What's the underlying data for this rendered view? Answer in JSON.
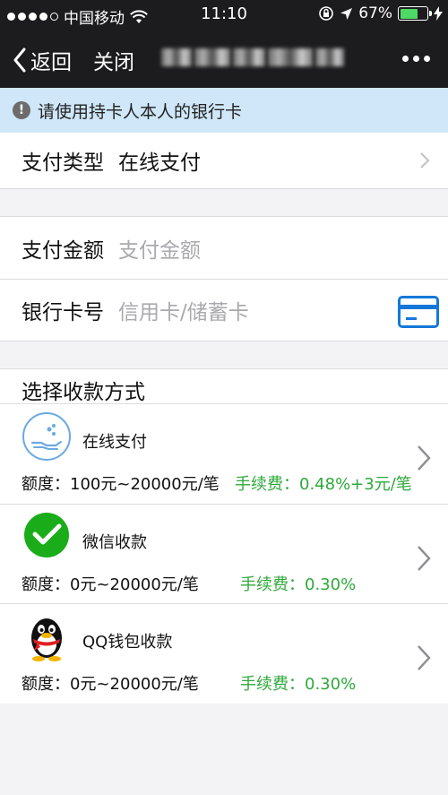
{
  "status_bar": {
    "carrier": "中国移动",
    "time": "11:10",
    "battery": "67%",
    "battery_level": 0.67
  },
  "nav": {
    "back_label": "返回",
    "close_label": "关闭"
  },
  "notice": {
    "text": "请使用持卡人本人的银行卡"
  },
  "form": {
    "pay_type_label": "支付类型",
    "pay_type_value": "在线支付",
    "amount_label": "支付金额",
    "amount_placeholder": "支付金额",
    "card_label": "银行卡号",
    "card_placeholder": "信用卡/储蓄卡"
  },
  "methods_title": "选择收款方式",
  "methods": [
    {
      "name": "在线支付",
      "limit": "额度：100元~20000元/笔",
      "fee": "手续费：0.48%+3元/笔",
      "icon": "online-pay-icon"
    },
    {
      "name": "微信收款",
      "limit": "额度：0元~20000元/笔",
      "fee": "手续费：0.30%",
      "icon": "wechat-icon"
    },
    {
      "name": "QQ钱包收款",
      "limit": "额度：0元~20000元/笔",
      "fee": "手续费：0.30%",
      "icon": "qq-penguin-icon"
    }
  ],
  "colors": {
    "accent_blue": "#1478d8",
    "fee_green": "#2fa83a",
    "notice_bg": "#cfe7f8",
    "wechat_green": "#1aad19"
  }
}
